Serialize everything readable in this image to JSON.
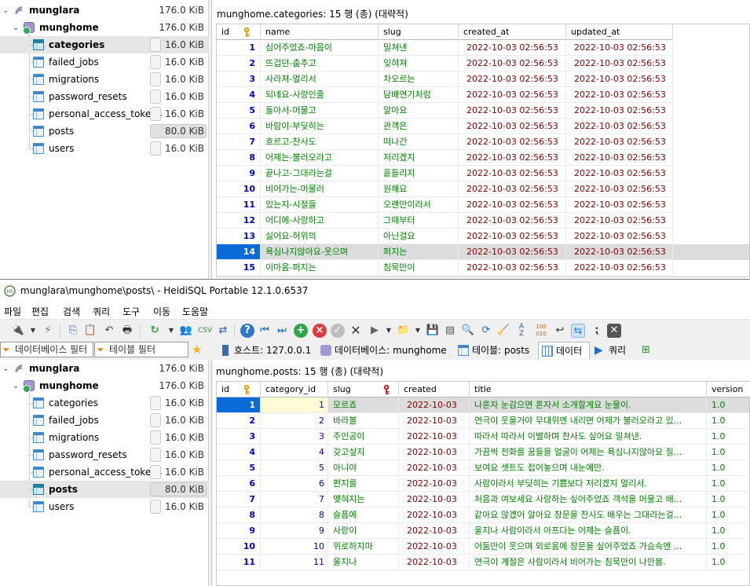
{
  "top_tree": {
    "server": {
      "label": "munglara",
      "size": "176.0 KiB"
    },
    "database": {
      "label": "munghome",
      "size": "176.0 KiB"
    },
    "tables": [
      {
        "label": "categories",
        "size": "16.0 KiB"
      },
      {
        "label": "failed_jobs",
        "size": "16.0 KiB"
      },
      {
        "label": "migrations",
        "size": "16.0 KiB"
      },
      {
        "label": "password_resets",
        "size": "16.0 KiB"
      },
      {
        "label": "personal_access_tokens",
        "size": "16.0 KiB"
      },
      {
        "label": "posts",
        "size": "80.0 KiB"
      },
      {
        "label": "users",
        "size": "16.0 KiB"
      }
    ]
  },
  "categories_grid": {
    "caption": "munghome.categories: 15 행 (총) (대략적)",
    "columns": [
      "id",
      "name",
      "slug",
      "created_at",
      "updated_at"
    ],
    "rows": [
      [
        "1",
        "심어주었죠-마음이",
        "밀쳐낸",
        "2022-10-03 02:56:53",
        "2022-10-03 02:56:53"
      ],
      [
        "2",
        "뜨겁던-춤추고",
        "잊혀져",
        "2022-10-03 02:56:53",
        "2022-10-03 02:56:53"
      ],
      [
        "3",
        "사라져-멀리서",
        "차오르는",
        "2022-10-03 02:56:53",
        "2022-10-03 02:56:53"
      ],
      [
        "4",
        "되네요-사랑인줄",
        "담배연기처럼",
        "2022-10-03 02:56:53",
        "2022-10-03 02:56:53"
      ],
      [
        "5",
        "돌아서-머물고",
        "알아요",
        "2022-10-03 02:56:53",
        "2022-10-03 02:56:53"
      ],
      [
        "6",
        "바람이-부딪히는",
        "관객은",
        "2022-10-03 02:56:53",
        "2022-10-03 02:56:53"
      ],
      [
        "7",
        "흐르고-찬사도",
        "떠나간",
        "2022-10-03 02:56:53",
        "2022-10-03 02:56:53"
      ],
      [
        "8",
        "어제는-불러오라고",
        "저리겠지",
        "2022-10-03 02:56:53",
        "2022-10-03 02:56:53"
      ],
      [
        "9",
        "끝나고-그대라는걸",
        "흩들리지",
        "2022-10-03 02:56:53",
        "2022-10-03 02:56:53"
      ],
      [
        "10",
        "비어가는-머물러",
        "원해요",
        "2022-10-03 02:56:53",
        "2022-10-03 02:56:53"
      ],
      [
        "11",
        "있는지-시절들",
        "오랜만이라서",
        "2022-10-03 02:56:53",
        "2022-10-03 02:56:53"
      ],
      [
        "12",
        "어디에-사랑하고",
        "그때부터",
        "2022-10-03 02:56:53",
        "2022-10-03 02:56:53"
      ],
      [
        "13",
        "싫어요-허위의",
        "아닌걸요",
        "2022-10-03 02:56:53",
        "2022-10-03 02:56:53"
      ],
      [
        "14",
        "욕심나지않아요-웃으며",
        "퍼지는",
        "2022-10-03 02:56:53",
        "2022-10-03 02:56:53"
      ],
      [
        "15",
        "이마음-퍼지는",
        "침묵만이",
        "2022-10-03 02:56:53",
        "2022-10-03 02:56:53"
      ]
    ]
  },
  "window": {
    "title": "munglara\\munghome\\posts\\ - HeidiSQL Portable 12.1.0.6537"
  },
  "menu": [
    "파일",
    "편집",
    "검색",
    "쿼리",
    "도구",
    "이동",
    "도움말"
  ],
  "filters": {
    "db_filter": "데이터베이스 필터",
    "table_filter": "테이블 필터"
  },
  "tabs": {
    "host": "호스트: 127.0.0.1",
    "database": "데이터베이스: munghome",
    "table": "테이블: posts",
    "data": "데이터",
    "query": "쿼리"
  },
  "bottom_tree": {
    "server": {
      "label": "munglara",
      "size": "176.0 KiB"
    },
    "database": {
      "label": "munghome",
      "size": "176.0 KiB"
    },
    "tables": [
      {
        "label": "categories",
        "size": "16.0 KiB"
      },
      {
        "label": "failed_jobs",
        "size": "16.0 KiB"
      },
      {
        "label": "migrations",
        "size": "16.0 KiB"
      },
      {
        "label": "password_resets",
        "size": "16.0 KiB"
      },
      {
        "label": "personal_access_tokens",
        "size": "16.0 KiB"
      },
      {
        "label": "posts",
        "size": "80.0 KiB"
      },
      {
        "label": "users",
        "size": "16.0 KiB"
      }
    ]
  },
  "posts_grid": {
    "caption": "munghome.posts: 15 행 (총) (대략적)",
    "columns": [
      "id",
      "category_id",
      "slug",
      "created",
      "title",
      "version"
    ],
    "rows": [
      [
        "1",
        "1",
        "모르죠",
        "2022-10-03",
        "나혼자 눈감으면 혼자서 소개할게요 눈물이.",
        "1.0"
      ],
      [
        "2",
        "2",
        "바라볼",
        "2022-10-03",
        "연극이 웃을거야 무대위엔 내리면 어제가 불러오라고 있...",
        "1.0"
      ],
      [
        "3",
        "3",
        "주인공이",
        "2022-10-03",
        "따라서 따라서 이별하며 찬사도 싶어요 밀쳐낸.",
        "1.0"
      ],
      [
        "4",
        "4",
        "갖고싶지",
        "2022-10-03",
        "가끔씩 전화를 꿈들을 얼굴이 어제는 욕심나지않아요 질...",
        "1.0"
      ],
      [
        "5",
        "5",
        "아니야",
        "2022-10-03",
        "보여요 셋트도 접어놓으며 내눈에만.",
        "1.0"
      ],
      [
        "6",
        "6",
        "편지를",
        "2022-10-03",
        "사람이라서 부딪히는 기쁨보다 저리겠지 멀리서.",
        "1.0"
      ],
      [
        "7",
        "7",
        "맺혀지는",
        "2022-10-03",
        "처음과 여보세요 사랑하는 싶어주었죠 객석을 머물고 배...",
        "1.0"
      ],
      [
        "8",
        "8",
        "슬픔에",
        "2022-10-03",
        "같아요 않겠어 알아요 창문을 찬사도 배우는 그대라는걸...",
        "1.0"
      ],
      [
        "9",
        "9",
        "사랑이",
        "2022-10-03",
        "울지나 사람이라서 아프다는 어제는 슬픔이.",
        "1.0"
      ],
      [
        "10",
        "10",
        "위로하지마",
        "2022-10-03",
        "어둠만이 웃으며 외로움에 장문을 싶어주었죠 가슴속엔 ...",
        "1.0"
      ],
      [
        "11",
        "11",
        "울지나",
        "2022-10-03",
        "연극이 계절은 사람이라서 비어가는 침묵만이 나만봄.",
        "1.0"
      ]
    ]
  }
}
